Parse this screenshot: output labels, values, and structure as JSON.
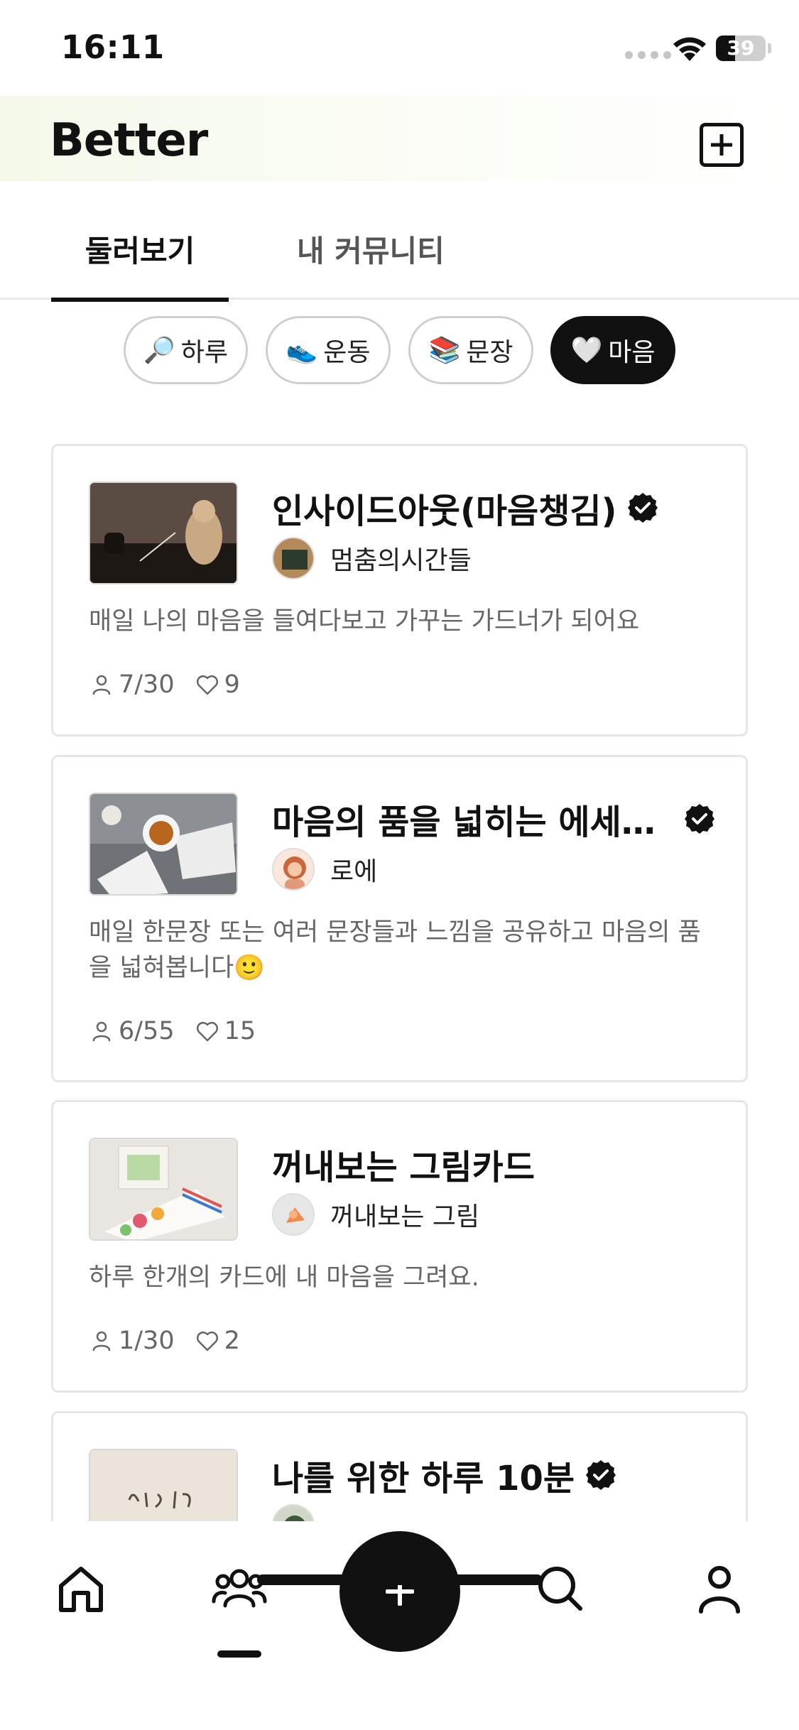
{
  "status_bar": {
    "time": "16:11",
    "battery": "39",
    "battery_level": 0.39
  },
  "header": {
    "logo": "Better"
  },
  "tabs": [
    {
      "label": "둘러보기",
      "active": true
    },
    {
      "label": "내 커뮤니티",
      "active": false
    }
  ],
  "chips": [
    {
      "emoji": "🔎",
      "label": "하루",
      "active": false
    },
    {
      "emoji": "👟",
      "label": "운동",
      "active": false
    },
    {
      "emoji": "📚",
      "label": "문장",
      "active": false
    },
    {
      "emoji": "🤍",
      "label": "마음",
      "active": true
    }
  ],
  "cards": [
    {
      "title": "인사이드아웃(마음챙김)",
      "verified": true,
      "owner": "멈춤의시간들",
      "description": "매일 나의 마음을 들여다보고 가꾸는 가드너가 되어요",
      "members": "7/30",
      "likes": "9"
    },
    {
      "title": "마음의 품을 넓히는 에세…",
      "verified": true,
      "owner": "로에",
      "description": "매일 한문장 또는 여러 문장들과 느낌을 공유하고 마음의 품을 넓혀봅니다🙂",
      "members": "6/55",
      "likes": "15"
    },
    {
      "title": "꺼내보는 그림카드",
      "verified": false,
      "owner": "꺼내보는 그림",
      "description": "하루 한개의 카드에 내 마음을 그려요.",
      "members": "1/30",
      "likes": "2"
    },
    {
      "title": "나를 위한 하루 10분",
      "verified": true,
      "owner": "",
      "description": "",
      "members": "",
      "likes": ""
    }
  ],
  "bottom_nav": {
    "items": [
      "home-icon",
      "community-icon",
      "add-icon",
      "search-icon",
      "profile-icon"
    ],
    "active": "community-icon"
  },
  "colors": {
    "accent": "#111111",
    "chip_border": "#cfcfcf",
    "muted_text": "#666666"
  }
}
